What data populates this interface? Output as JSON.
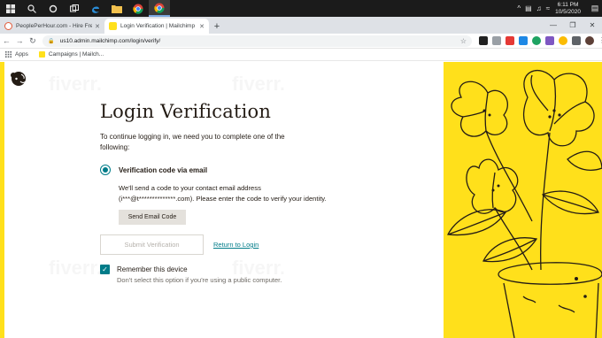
{
  "taskbar": {
    "clock_time": "6:11 PM",
    "clock_date": "10/5/2020",
    "tray_chevron": "^"
  },
  "tabs": [
    {
      "title": "PeoplePerHour.com - Hire Freela",
      "favicon_color": "#e25b3a",
      "active": false
    },
    {
      "title": "Login Verification | Mailchimp",
      "favicon_color": "#ffe01b",
      "active": true
    }
  ],
  "address": {
    "url": "us10.admin.mailchimp.com/login/verify/"
  },
  "bookmarks": [
    {
      "label": "Apps",
      "icon": "apps-grid-icon"
    },
    {
      "label": "Campaigns | Mailch...",
      "icon": "mailchimp-icon"
    }
  ],
  "page": {
    "title": "Login Verification",
    "intro": "To continue logging in, we need you to complete one of the following:",
    "option_label": "Verification code via email",
    "option_desc": "We'll send a code to your contact email address (i***@t**************.com). Please enter the code to verify your identity.",
    "send_button": "Send Email Code",
    "submit_button": "Submit Verification",
    "return_link": "Return to Login",
    "remember_label": "Remember this device",
    "remember_hint": "Don't select this option if you're using a public computer.",
    "remember_checked": true,
    "watermark": "fiverr."
  },
  "colors": {
    "accent_teal": "#007c89",
    "brand_yellow": "#ffe01b",
    "text": "#241c15"
  }
}
